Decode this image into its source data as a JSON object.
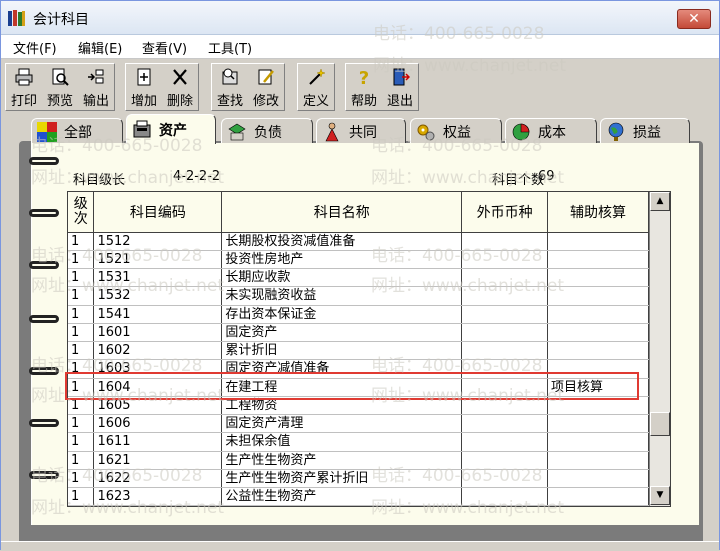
{
  "window": {
    "title": "会计科目",
    "close_label": "✕"
  },
  "menu": [
    "文件(F)",
    "编辑(E)",
    "查看(V)",
    "工具(T)"
  ],
  "toolbar": {
    "print": "打印",
    "preview": "预览",
    "export": "输出",
    "add": "增加",
    "delete": "删除",
    "find": "查找",
    "edit": "修改",
    "define": "定义",
    "help": "帮助",
    "exit": "退出"
  },
  "tabs": [
    "全部",
    "资产",
    "负债",
    "共同",
    "权益",
    "成本",
    "损益"
  ],
  "active_tab": "资产",
  "info": {
    "level_label": "科目级长",
    "level_value": "4-2-2-2",
    "count_label": "科目个数",
    "count_value": "69"
  },
  "table": {
    "headers": {
      "level": "级\n次",
      "code": "科目编码",
      "name": "科目名称",
      "currency": "外币币种",
      "aux": "辅助核算"
    },
    "rows": [
      [
        "1",
        "1512",
        "长期股权投资减值准备",
        "",
        ""
      ],
      [
        "1",
        "1521",
        "投资性房地产",
        "",
        ""
      ],
      [
        "1",
        "1531",
        "长期应收款",
        "",
        ""
      ],
      [
        "1",
        "1532",
        "未实现融资收益",
        "",
        ""
      ],
      [
        "1",
        "1541",
        "存出资本保证金",
        "",
        ""
      ],
      [
        "1",
        "1601",
        "固定资产",
        "",
        ""
      ],
      [
        "1",
        "1602",
        "累计折旧",
        "",
        ""
      ],
      [
        "1",
        "1603",
        "固定资产减值准备",
        "",
        ""
      ],
      [
        "1",
        "1604",
        "在建工程",
        "",
        "项目核算"
      ],
      [
        "1",
        "1605",
        "工程物资",
        "",
        ""
      ],
      [
        "1",
        "1606",
        "固定资产清理",
        "",
        ""
      ],
      [
        "1",
        "1611",
        "未担保余值",
        "",
        ""
      ],
      [
        "1",
        "1621",
        "生产性生物资产",
        "",
        ""
      ],
      [
        "1",
        "1622",
        "生产性生物资产累计折旧",
        "",
        ""
      ],
      [
        "1",
        "1623",
        "公益性生物资产",
        "",
        ""
      ]
    ],
    "highlighted_code": "1604"
  },
  "watermark": {
    "phone": "电话：400-665-0028",
    "site": "网址：www.chanjet.net"
  },
  "colors": {
    "highlight": "#e03a32",
    "page": "#fcfcec",
    "chrome": "#d4d0c8"
  }
}
